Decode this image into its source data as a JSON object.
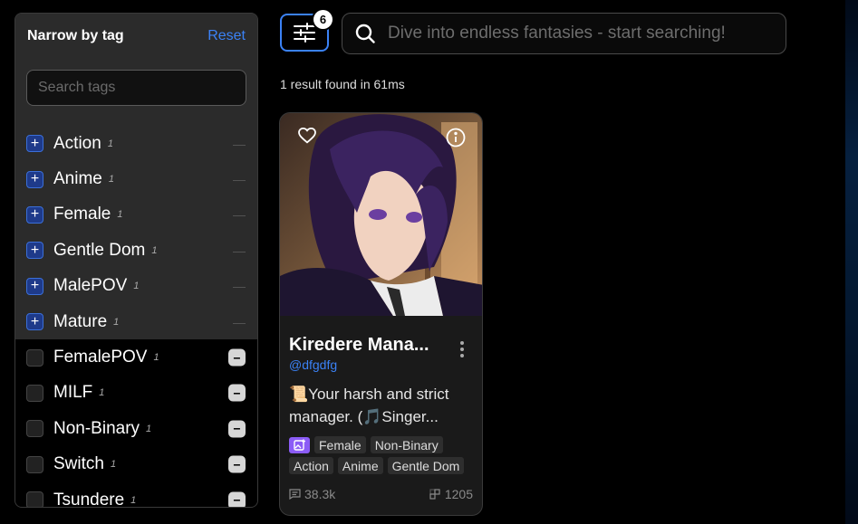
{
  "sidebar": {
    "title": "Narrow by tag",
    "reset_label": "Reset",
    "search_placeholder": "Search tags",
    "tags": [
      {
        "label": "Action",
        "count": "1",
        "state": "included"
      },
      {
        "label": "Anime",
        "count": "1",
        "state": "included"
      },
      {
        "label": "Female",
        "count": "1",
        "state": "included"
      },
      {
        "label": "Gentle Dom",
        "count": "1",
        "state": "included"
      },
      {
        "label": "MalePOV",
        "count": "1",
        "state": "included"
      },
      {
        "label": "Mature",
        "count": "1",
        "state": "included"
      },
      {
        "label": "FemalePOV",
        "count": "1",
        "state": "none"
      },
      {
        "label": "MILF",
        "count": "1",
        "state": "none"
      },
      {
        "label": "Non-Binary",
        "count": "1",
        "state": "none"
      },
      {
        "label": "Switch",
        "count": "1",
        "state": "none"
      },
      {
        "label": "Tsundere",
        "count": "1",
        "state": "none"
      }
    ]
  },
  "toolbar": {
    "filter_badge": "6",
    "search_placeholder": "Dive into endless fantasies - start searching!"
  },
  "results": {
    "summary": "1 result found in 61ms"
  },
  "card": {
    "title": "Kiredere Mana...",
    "author": "@dfgdfg",
    "description": "📜Your harsh and strict manager. (🎵Singer...",
    "tags_row1": [
      "Female",
      "Non-Binary"
    ],
    "tags_row2": [
      "Action",
      "Anime",
      "Gentle Dom"
    ],
    "messages": "38.3k",
    "interactions": "1205"
  },
  "icons": {
    "filter": "sliders-icon",
    "search": "search-icon",
    "heart": "heart-icon",
    "info": "info-icon",
    "more": "more-vertical-icon",
    "image_gen": "image-plus-icon",
    "messages": "chat-icon",
    "interactions": "grid-plus-icon"
  },
  "colors": {
    "accent": "#3b82f6",
    "tag_included_bg": "#1e3a8a",
    "image_chip": "#8b5cf6"
  }
}
